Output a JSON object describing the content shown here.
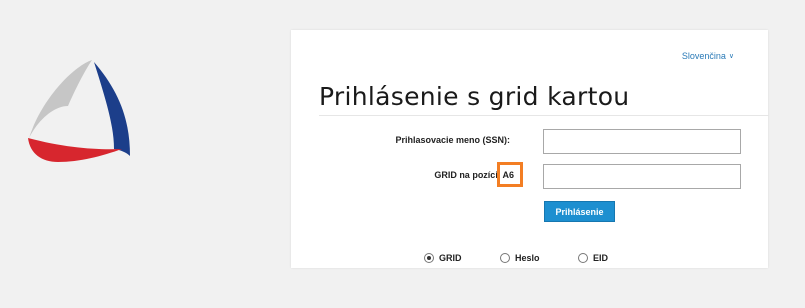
{
  "language": {
    "label": "Slovenčina",
    "chevron": "∨"
  },
  "title": "Prihlásenie s grid kartou",
  "form": {
    "username_label": "Prihlasovacie meno (SSN):",
    "username_value": "",
    "grid_label": "GRID na pozícii A6",
    "grid_value": "",
    "submit_label": "Prihlásenie"
  },
  "methods": [
    {
      "label": "GRID",
      "selected": true
    },
    {
      "label": "Heslo",
      "selected": false
    },
    {
      "label": "EID",
      "selected": false
    }
  ],
  "colors": {
    "accent": "#1d8fd0",
    "highlight": "#f37e23",
    "logo_red": "#d7262e",
    "logo_blue": "#1c3e8a",
    "logo_gray": "#c6c6c6"
  },
  "icons": {
    "logo": "triangle-logo-icon"
  }
}
